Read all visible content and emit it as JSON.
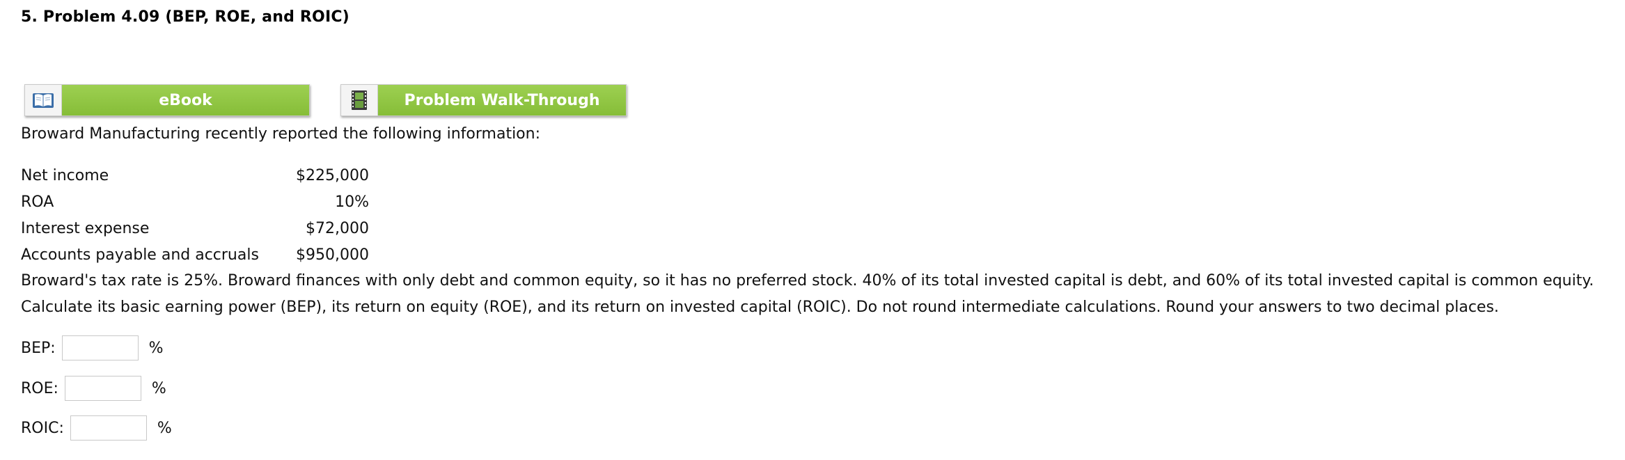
{
  "problem": {
    "title": "5.  Problem 4.09 (BEP, ROE, and ROIC)"
  },
  "resources": {
    "ebook": {
      "label": "eBook",
      "icon": "book-icon"
    },
    "walkthrough": {
      "label": "Problem Walk-Through",
      "icon": "film-icon"
    }
  },
  "intro": "Broward Manufacturing recently reported the following information:",
  "info_table": [
    {
      "label": "Net income",
      "value": "$225,000"
    },
    {
      "label": "ROA",
      "value": "10%"
    },
    {
      "label": "Interest expense",
      "value": "$72,000"
    },
    {
      "label": "Accounts payable and accruals",
      "value": "$950,000"
    }
  ],
  "paragraph": {
    "line1": "Broward's tax rate is 25%. Broward finances with only debt and common equity, so it has no preferred stock. 40% of its total invested capital is debt, and 60% of its total invested capital is common equity.",
    "line2": "Calculate its basic earning power (BEP), its return on equity (ROE), and its return on invested capital (ROIC). Do not round intermediate calculations. Round your answers to two decimal places."
  },
  "answers": [
    {
      "label": "BEP:",
      "value": "",
      "unit": "%"
    },
    {
      "label": "ROE:",
      "value": "",
      "unit": "%"
    },
    {
      "label": "ROIC:",
      "value": "",
      "unit": "%"
    }
  ],
  "colors": {
    "button_green": "#8dc63f",
    "text": "#111111"
  }
}
